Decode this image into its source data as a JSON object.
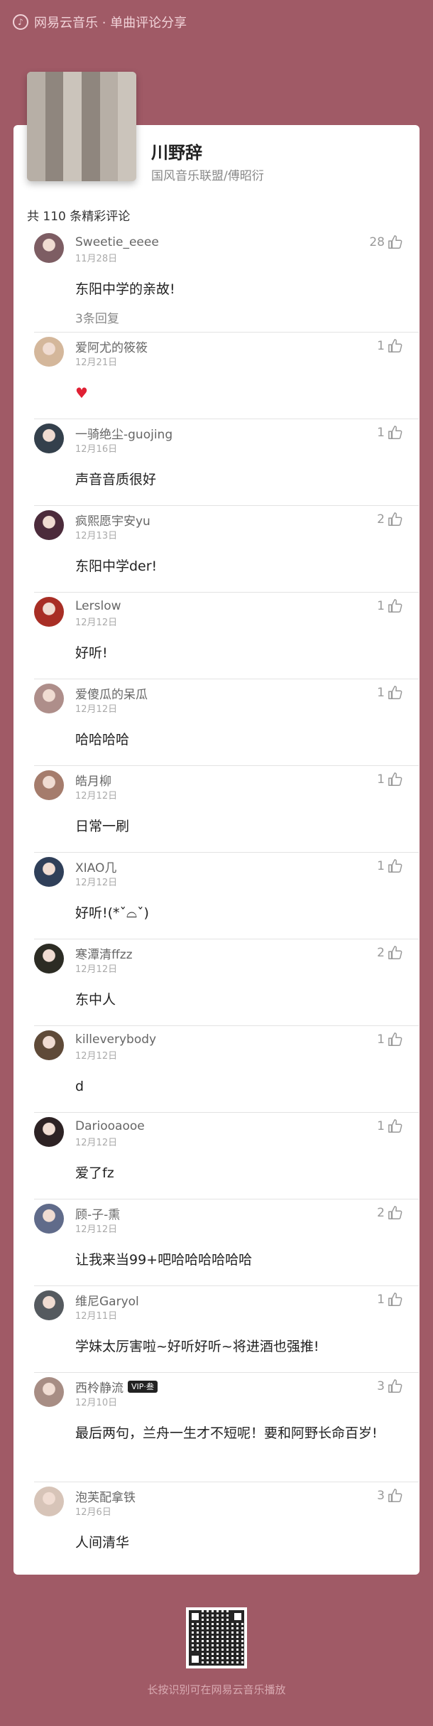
{
  "header": {
    "app_title": "网易云音乐 · 单曲评论分享",
    "logo_icon": "netease-music-logo-icon"
  },
  "song": {
    "title": "川野辞",
    "artist": "国风音乐联盟/傅昭衍",
    "cover_icon": "album-cover"
  },
  "comments_header": "共 110 条精彩评论",
  "comments": [
    {
      "user": "Sweetie_eeee",
      "date": "11月28日",
      "text": "东阳中学的亲故!",
      "likes": "28",
      "replies": "3条回复"
    },
    {
      "user": "爱阿尤的筱筱",
      "date": "12月21日",
      "text": "",
      "heart": "♥",
      "likes": "1"
    },
    {
      "user": "一骑绝尘-guojing",
      "date": "12月16日",
      "text": "声音音质很好",
      "likes": "1"
    },
    {
      "user": "疯熙愿宇安yu",
      "date": "12月13日",
      "text": "东阳中学der!",
      "likes": "2"
    },
    {
      "user": "Lerslow",
      "date": "12月12日",
      "text": "好听!",
      "likes": "1"
    },
    {
      "user": "爱傻瓜的呆瓜",
      "date": "12月12日",
      "text": "哈哈哈哈",
      "likes": "1"
    },
    {
      "user": "皓月柳",
      "date": "12月12日",
      "text": "日常一刷",
      "likes": "1"
    },
    {
      "user": "XIAO几",
      "date": "12月12日",
      "text": "好听!(*ˇ⌓ˇ)",
      "likes": "1"
    },
    {
      "user": "寒潭清ffzz",
      "date": "12月12日",
      "text": "东中人",
      "likes": "2"
    },
    {
      "user": "killeverybody",
      "date": "12月12日",
      "text": "d",
      "likes": "1"
    },
    {
      "user": "Dariooaooe",
      "date": "12月12日",
      "text": "爱了fz",
      "likes": "1"
    },
    {
      "user": "顾-子-熏",
      "date": "12月12日",
      "text": "让我来当99+吧哈哈哈哈哈哈",
      "likes": "2"
    },
    {
      "user": "维尼Garyol",
      "date": "12月11日",
      "text": "学妹太厉害啦~好听好听~将进酒也强推!",
      "likes": "1"
    },
    {
      "user": "西柃静流",
      "vip": "VIP·叁",
      "date": "12月10日",
      "text": "最后两句，兰舟一生才不短呢！要和阿野长命百岁!",
      "likes": "3"
    },
    {
      "user": "泡芙配拿铁",
      "date": "12月6日",
      "text": "人间清华",
      "likes": "3"
    }
  ],
  "footer": {
    "qr_icon": "qr-code",
    "hint": "长按识别可在网易云音乐播放"
  },
  "colors": {
    "background": "#a05a66",
    "card": "#ffffff"
  }
}
